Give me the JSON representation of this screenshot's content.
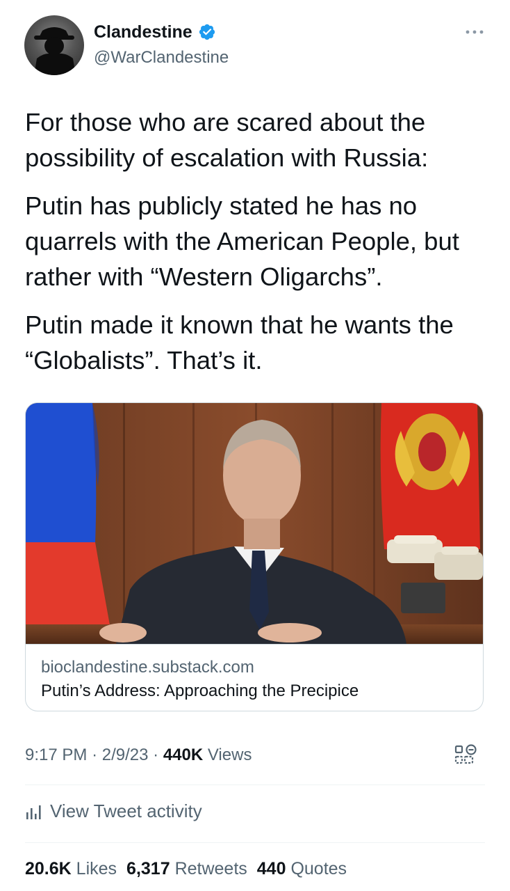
{
  "author": {
    "display_name": "Clandestine",
    "handle": "@WarClandestine",
    "verified_color": "#1d9bf0"
  },
  "tweet": {
    "paragraphs": [
      "For those who are scared about the possibility of escalation with Russia:",
      "Putin has publicly stated he has no quarrels with the American People, but rather with “Western Oligarchs”.",
      "Putin made it known that he wants the “Globalists”. That’s it."
    ]
  },
  "link_card": {
    "domain": "bioclandestine.substack.com",
    "title": "Putin’s Address: Approaching the Precipice"
  },
  "meta": {
    "time": "9:17 PM",
    "separator": "·",
    "date": "2/9/23",
    "views_count": "440K",
    "views_label": "Views"
  },
  "activity": {
    "label": "View Tweet activity"
  },
  "stats": {
    "likes_count": "20.6K",
    "likes_label": "Likes",
    "retweets_count": "6,317",
    "retweets_label": "Retweets",
    "quotes_count": "440",
    "quotes_label": "Quotes"
  },
  "icons": {
    "verified": "verified-badge-icon",
    "more": "more-options-icon",
    "qr": "qr-code-icon",
    "activity": "bar-chart-icon"
  }
}
